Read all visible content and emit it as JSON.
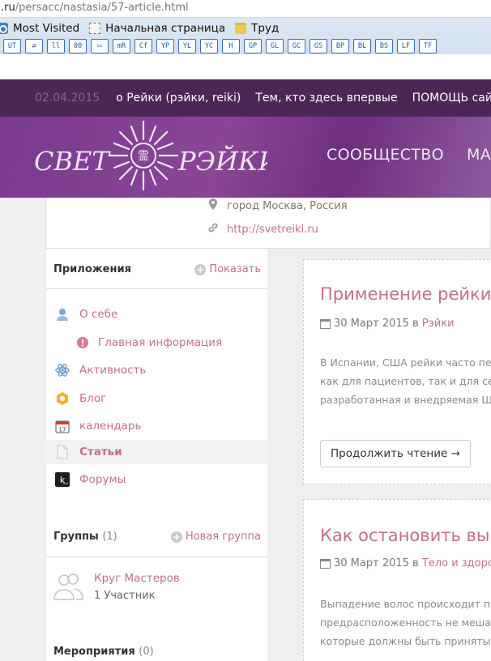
{
  "browser": {
    "url_domain": ".ru",
    "url_path": "/persacc/nastasia/57-article.html",
    "bookmarks": [
      {
        "label": "Most Visited",
        "icon": "most-visited-icon"
      },
      {
        "label": "Начальная страница",
        "icon": "page-icon"
      },
      {
        "label": "Труд",
        "icon": "folder-icon"
      }
    ],
    "toolbar_buttons": [
      "UT",
      "⇄",
      "ll",
      "00",
      "▭",
      "mR",
      "Cf",
      "YP",
      "YL",
      "YC",
      "H",
      "GP",
      "GL",
      "GC",
      "GS",
      "BP",
      "BL",
      "BS",
      "LF",
      "TF"
    ]
  },
  "topbar": {
    "date": "02.04.2015",
    "links": [
      "о Рейки (рэйки, reiki)",
      "Тем, кто здесь впервые",
      "ПОМОЩЬ сайту"
    ]
  },
  "header": {
    "logo_left": "СВЕТ",
    "logo_right": "РЭЙКИ",
    "nav": [
      "СООБЩЕСТВО",
      "МА"
    ]
  },
  "profile": {
    "location": "город Москва, Россия",
    "website": "http://svetreiki.ru"
  },
  "apps": {
    "title": "Приложения",
    "action": "Показать",
    "items": [
      {
        "label": "О себе",
        "icon": "user-icon"
      },
      {
        "label": "Главная информация",
        "icon": "info-icon"
      },
      {
        "label": "Активность",
        "icon": "atom-icon"
      },
      {
        "label": "Блог",
        "icon": "blog-icon"
      },
      {
        "label": "календарь",
        "icon": "calendar-icon"
      },
      {
        "label": "Статьи",
        "icon": "document-icon"
      },
      {
        "label": "Форумы",
        "icon": "forum-icon"
      }
    ]
  },
  "groups": {
    "title": "Группы",
    "count": "(1)",
    "action": "Новая группа",
    "items": [
      {
        "name": "Круг Мастеров",
        "members": "1 Участник"
      }
    ]
  },
  "events": {
    "title": "Мероприятия",
    "count": "(0)"
  },
  "articles": [
    {
      "title": "Применение рейки: р",
      "date": "30 Март 2015",
      "in": "в",
      "category": "Рэйки",
      "lines": [
        "В Испании, США рейки часто пе",
        "как для пациентов, так и для се",
        "разработанная и внедряемая Ш"
      ],
      "button": "Продолжить чтение →"
    },
    {
      "title": "Как остановить выпа",
      "date": "30 Март 2015",
      "in": "в",
      "category": "Тело и здоро",
      "lines": [
        "Выпадение волос происходит п",
        "предрасположенность не меша",
        "которые должны быть приняты"
      ]
    }
  ],
  "colors": {
    "accent": "#c0708a",
    "topbar_bg": "#4b2756",
    "header_bg": "#7a3a8e"
  }
}
